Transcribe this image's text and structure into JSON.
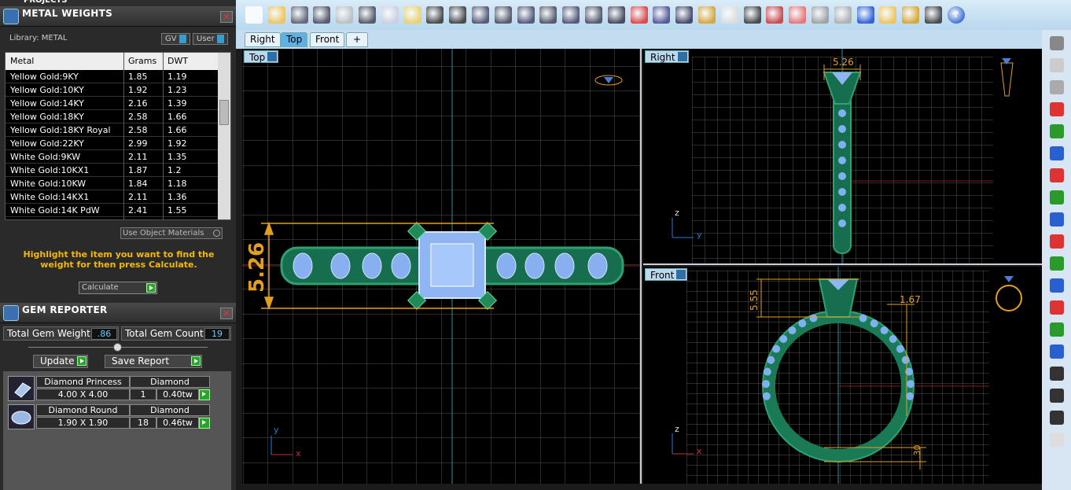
{
  "projects_label": "PROJECTS",
  "metal_panel": {
    "title": "METAL WEIGHTS",
    "library": "Library: METAL",
    "gv": "GV",
    "user": "User",
    "columns": [
      "Metal",
      "Grams",
      "DWT"
    ],
    "rows": [
      [
        "Yellow Gold:9KY",
        "1.85",
        "1.19"
      ],
      [
        "Yellow Gold:10KY",
        "1.92",
        "1.23"
      ],
      [
        "Yellow Gold:14KY",
        "2.16",
        "1.39"
      ],
      [
        "Yellow Gold:18KY",
        "2.58",
        "1.66"
      ],
      [
        "Yellow Gold:18KY Royal",
        "2.58",
        "1.66"
      ],
      [
        "Yellow Gold:22KY",
        "2.99",
        "1.92"
      ],
      [
        "White Gold:9KW",
        "2.11",
        "1.35"
      ],
      [
        "White Gold:10KX1",
        "1.87",
        "1.2"
      ],
      [
        "White Gold:10KW",
        "1.84",
        "1.18"
      ],
      [
        "White Gold:14KX1",
        "2.11",
        "1.36"
      ],
      [
        "White Gold:14K PdW",
        "2.41",
        "1.55"
      ]
    ],
    "use_object_materials": "Use Object Materials",
    "hint": "Highlight the item you want to find the weight for then press Calculate.",
    "calculate": "Calculate"
  },
  "gem_panel": {
    "title": "GEM REPORTER",
    "total_weight_label": "Total Gem Weight",
    "total_weight": ".86",
    "total_count_label": "Total Gem Count",
    "total_count": "19",
    "update": "Update",
    "save_report": "Save Report",
    "gems": [
      {
        "shape": "Diamond Princess",
        "material": "Diamond",
        "size": "4.00 X 4.00",
        "count": "1",
        "weight": "0.40tw"
      },
      {
        "shape": "Diamond Round",
        "material": "Diamond",
        "size": "1.90 X 1.90",
        "count": "18",
        "weight": "0.46tw"
      }
    ]
  },
  "tabs": [
    "Right",
    "Top",
    "Front"
  ],
  "viewports": {
    "top": {
      "label": "Top",
      "dim": "5.26"
    },
    "right": {
      "label": "Right",
      "dim": "5.26"
    },
    "front": {
      "label": "Front",
      "dim1": "5.55",
      "dim2": "1.67",
      "dim3": ".30"
    }
  },
  "axes": {
    "x": "x",
    "y": "y",
    "z": "z"
  }
}
